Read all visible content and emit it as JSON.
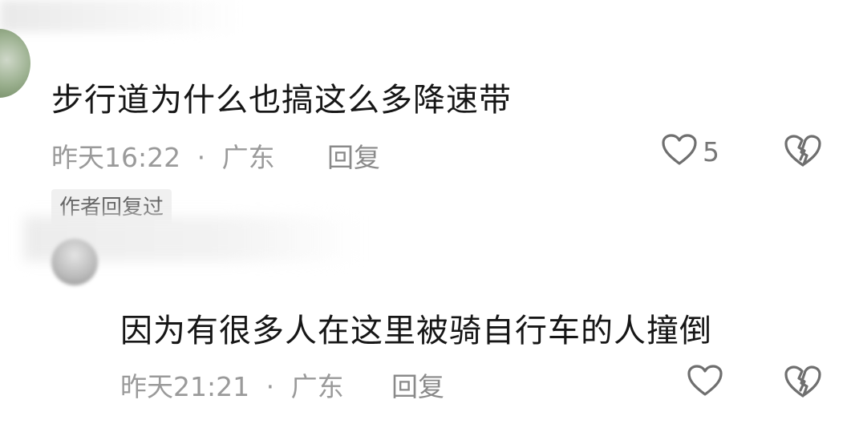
{
  "comment": {
    "text": "步行道为什么也搞这么多降速带",
    "time": "昨天16:22",
    "location": "广东",
    "separator": "·",
    "reply_label": "回复",
    "like_count": "5",
    "author_replied_badge": "作者回复过"
  },
  "reply": {
    "text": "因为有很多人在这里被骑自行车的人撞倒",
    "time": "昨天21:21",
    "location": "广东",
    "separator": "·",
    "reply_label": "回复"
  },
  "icons": {
    "like": "heart-outline-icon",
    "dislike": "broken-heart-outline-icon"
  },
  "colors": {
    "text": "#161616",
    "meta": "#9a9a9a",
    "icon": "#6f6f6f"
  }
}
